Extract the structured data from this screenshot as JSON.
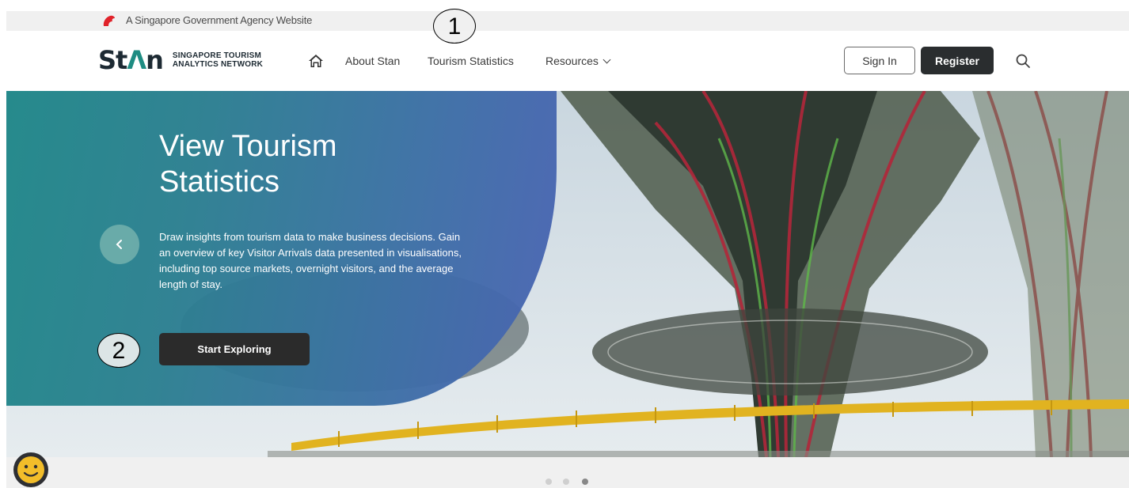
{
  "gov_bar": {
    "text": "A Singapore Government Agency Website"
  },
  "logo": {
    "word_start": "St",
    "word_end": "n",
    "subtitle_line1": "SINGAPORE TOURISM",
    "subtitle_line2": "ANALYTICS NETWORK"
  },
  "nav": {
    "home_icon": "home-icon",
    "about": "About Stan",
    "tourism": "Tourism Statistics",
    "resources": "Resources"
  },
  "auth": {
    "sign_in": "Sign In",
    "register": "Register"
  },
  "hero": {
    "title": "View Tourism Statistics",
    "description": "Draw insights from tourism data to make business decisions. Gain an overview of key Visitor Arrivals data presented in visualisations, including top source markets, overnight visitors, and the average length of stay.",
    "cta": "Start Exploring"
  },
  "callouts": [
    "1",
    "2"
  ],
  "carousel": {
    "slides": 3,
    "active": 3
  },
  "colors": {
    "teal": "#1b8a86",
    "blue": "#4a63b3",
    "dark_button": "#2a2d2f",
    "lion_red": "#e0222a"
  }
}
